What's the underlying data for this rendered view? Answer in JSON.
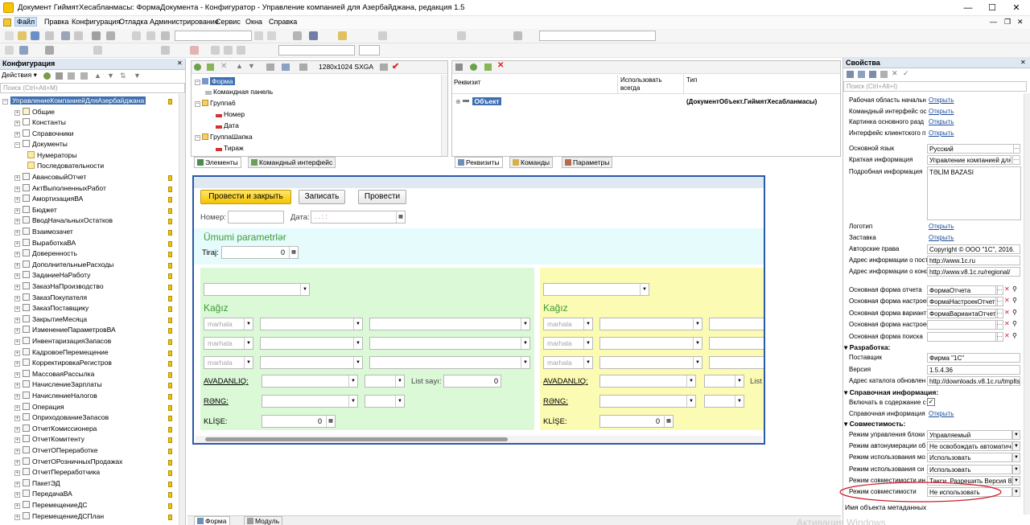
{
  "window": {
    "title": "Документ ГиймятХесабланмасы: ФормаДокумента - Конфигуратор - Управление компанией для Азербайджана, редакция 1.5",
    "minimize": "—",
    "maximize": "☐",
    "close": "✕"
  },
  "menu": [
    "Файл",
    "Правка",
    "Конфигурация",
    "Отладка",
    "Администрирование",
    "Сервис",
    "Окна",
    "Справка"
  ],
  "toolbar": {
    "resolution": "1280x1024 SXGA"
  },
  "config_panel": {
    "title": "Конфигурация",
    "actions": "Действия",
    "search_placeholder": "Поиск (Ctrl+Alt+M)",
    "root": "УправлениеКомпаниейДляАзербайджана",
    "groups": [
      "Общие",
      "Константы",
      "Справочники",
      "Документы"
    ],
    "doc_children": [
      "Нумераторы",
      "Последовательности"
    ],
    "documents": [
      "АвансовыйОтчет",
      "АктВыполненныхРабот",
      "АмортизацияВА",
      "Бюджет",
      "ВводНачальныхОстатков",
      "Взаимозачет",
      "ВыработкаВА",
      "Доверенность",
      "ДополнительныеРасходы",
      "ЗаданиеНаРаботу",
      "ЗаказНаПроизводство",
      "ЗаказПокупателя",
      "ЗаказПоставщику",
      "ЗакрытиеМесяца",
      "ИзменениеПараметровВА",
      "ИнвентаризацияЗапасов",
      "КадровоеПеремещение",
      "КорректировкаРегистров",
      "МассоваяРассылка",
      "НачислениеЗарплаты",
      "НачислениеНалогов",
      "Операция",
      "ОприходованиеЗапасов",
      "ОтчетКомиссионера",
      "ОтчетКомитенту",
      "ОтчетОПереработке",
      "ОтчетОРозничныхПродажах",
      "ОтчетПереработчика",
      "ПакетЭД",
      "ПередачаВА",
      "ПеремещениеДС",
      "ПеремещениеДСПлан"
    ]
  },
  "form_tree": {
    "items": [
      "Форма",
      "Командная панель",
      "Группа6",
      "Номер",
      "Дата",
      "ГруппаШапка",
      "Тираж"
    ],
    "tabs": [
      "Элементы",
      "Командный интерфейс"
    ]
  },
  "requisites": {
    "col_requisite": "Реквизит",
    "col_always_line1": "Использовать",
    "col_always_line2": "всегда",
    "col_type": "Тип",
    "object_name": "Объект",
    "object_type": "(ДокументОбъект.ГиймятХесабланмасы)",
    "tabs": [
      "Реквизиты",
      "Команды",
      "Параметры"
    ]
  },
  "preview": {
    "btn_post_close": "Провести и закрыть",
    "btn_save": "Записать",
    "btn_post": "Провести",
    "number_label": "Номер:",
    "date_label": "Дата:",
    "date_mask": ".  .       :  :",
    "section_title": "Ümumi parametrlər",
    "tiraj_label": "Tiraj:",
    "tiraj_value": "0",
    "kagiz": "Kağız",
    "marhala": "marhala",
    "avadanliq": "AVADANLIQ:",
    "list_sayi": "List sayı:",
    "list_sayi_value": "0",
    "list_short": "List",
    "reng": "RƏNG:",
    "klise": "KLİŞE:",
    "zero": "0"
  },
  "bottom_tabs": [
    "Форма",
    "Модуль"
  ],
  "properties": {
    "title": "Свойства",
    "search_placeholder": "Поиск (Ctrl+Alt+I)",
    "rows_top": [
      {
        "label": "Рабочая область начальн",
        "value": "Открыть"
      },
      {
        "label": "Командный интерфейс ос",
        "value": "Открыть"
      },
      {
        "label": "Картинка основного разд",
        "value": "Открыть"
      },
      {
        "label": "Интерфейс клиентского п",
        "value": "Открыть"
      }
    ],
    "main_language_label": "Основной язык",
    "main_language": "Русский",
    "short_info_label": "Краткая информация",
    "short_info": "Управление компанией для",
    "detailed_info_label": "Подробная информация",
    "detailed_info": "TƏLİM BAZASI",
    "logo_label": "Логотип",
    "logo": "Открыть",
    "splash_label": "Заставка",
    "splash": "Открыть",
    "copyright_label": "Авторские права",
    "copyright": "Copyright © ООО \"1С\", 2016.",
    "addr_post_label": "Адрес информации о пост",
    "addr_post": "http://www.1c.ru",
    "addr_conf_label": "Адрес информации о конф",
    "addr_conf": "http://www.v8.1c.ru/regional/",
    "forms": [
      {
        "label": "Основная форма отчета",
        "value": "ФормаОтчета"
      },
      {
        "label": "Основная форма настроек",
        "value": "ФормаНастроекОтчет"
      },
      {
        "label": "Основная форма вариант",
        "value": "ФормаВариантаОтчет"
      },
      {
        "label": "Основная форма настроек",
        "value": ""
      },
      {
        "label": "Основная форма поиска",
        "value": ""
      }
    ],
    "dev_section": "Разработка:",
    "vendor_label": "Поставщик",
    "vendor": "Фирма \"1С\"",
    "version_label": "Версия",
    "version": "1.5.4.36",
    "catalog_label": "Адрес каталога обновлен",
    "catalog": "http://downloads.v8.1c.ru/tmplts",
    "ref_section": "Справочная информация:",
    "include_label": "Включать в содержание с",
    "ref_info_label": "Справочная информация",
    "ref_info": "Открыть",
    "compat_section": "Совместимость:",
    "compat": [
      {
        "label": "Режим управления блоки",
        "value": "Управляемый"
      },
      {
        "label": "Режим автонумерации об",
        "value": "Не освобождать автоматиче"
      },
      {
        "label": "Режим использования мо",
        "value": "Использовать"
      },
      {
        "label": "Режим использования си",
        "value": "Использовать"
      },
      {
        "label": "Режим совместимости ин",
        "value": "Такси. Разрешить Версия 8."
      },
      {
        "label": "Режим совместимости",
        "value": "Не использовать"
      }
    ],
    "footer": "Имя объекта метаданных"
  },
  "watermark": "Активация Windows"
}
